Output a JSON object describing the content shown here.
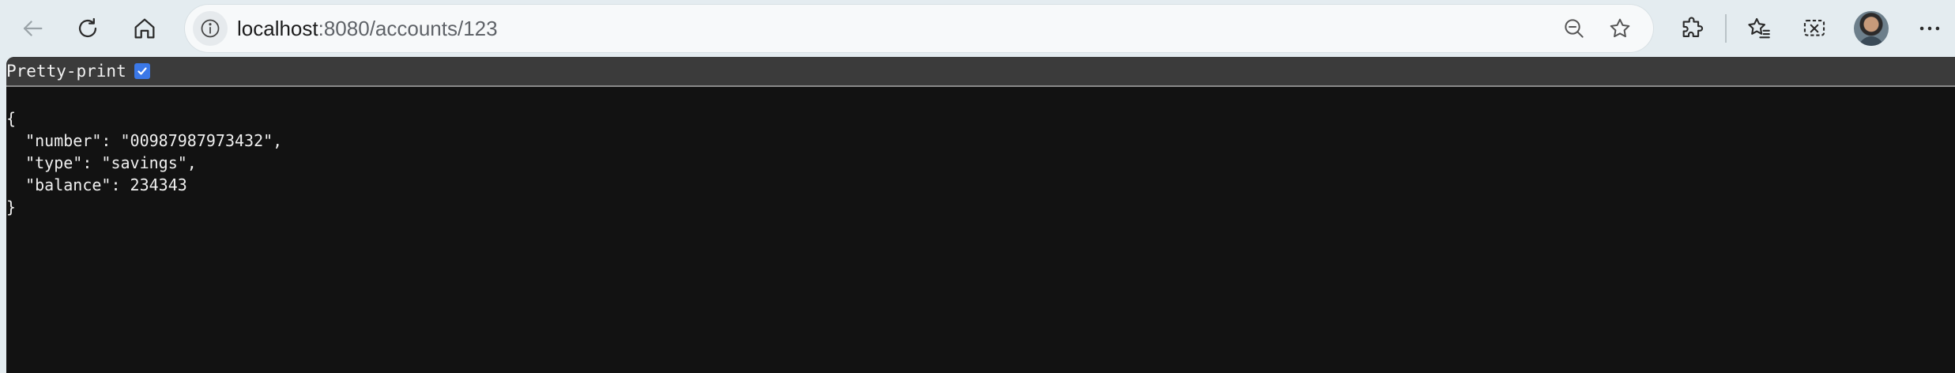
{
  "browser": {
    "nav": {
      "back_icon": "arrow-left-icon",
      "reload_icon": "reload-icon",
      "home_icon": "home-icon"
    },
    "address_bar": {
      "host": "localhost",
      "rest": ":8080/accounts/123",
      "site_info_icon": "info-icon",
      "zoom_icon": "zoom-out-icon",
      "favorite_icon": "star-icon"
    },
    "right_icons": [
      "extensions-icon",
      "favorites-icon",
      "collections-icon",
      "avatar",
      "more-icon"
    ]
  },
  "page": {
    "pretty_print_label": "Pretty-print",
    "pretty_print_checked": true,
    "json_lines": [
      "{",
      "  \"number\": \"00987987973432\",",
      "  \"type\": \"savings\",",
      "  \"balance\": 234343",
      "}"
    ],
    "colors": {
      "background": "#121212",
      "bar": "#3b3b3b",
      "text": "#f0f0f0",
      "checkbox": "#3b78e7"
    }
  }
}
